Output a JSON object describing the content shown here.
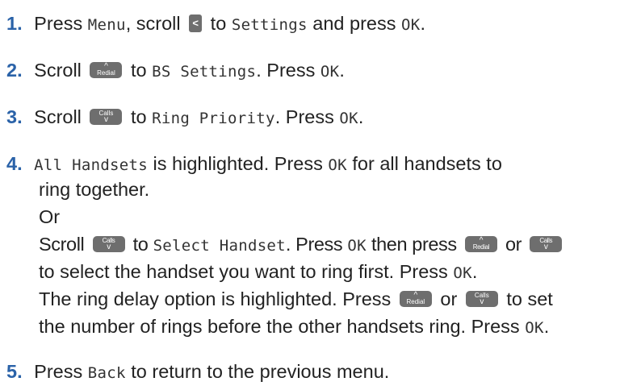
{
  "steps": {
    "s1": {
      "num": "1",
      "t1": "Press ",
      "menu": "Menu",
      "t2": ", scroll ",
      "t3": " to ",
      "settings": "Settings",
      "t4": " and press ",
      "ok": "OK",
      "t5": "."
    },
    "s2": {
      "num": "2",
      "t1": "Scroll ",
      "t2": " to ",
      "bs": "BS Settings",
      "t3": ". Press ",
      "ok": "OK",
      "t4": "."
    },
    "s3": {
      "num": "3",
      "t1": "Scroll ",
      "t2": " to ",
      "ring": "Ring Priority",
      "t3": ". Press ",
      "ok": "OK",
      "t4": "."
    },
    "s4": {
      "num": "4",
      "all": "All Handsets",
      "t1": " is highlighted. Press ",
      "ok": "OK",
      "t2": " for all handsets to",
      "l2": "ring together.",
      "or": "Or",
      "l4a": "Scroll ",
      "l4b": " to ",
      "select": "Select Handset",
      "l4c": ". Press ",
      "l4d": " then press ",
      "l4e": " or ",
      "l5a": "to select the handset you want to ring first. Press ",
      "l5b": ".",
      "l6a": "The ring delay option is highlighted. Press ",
      "l6b": " or ",
      "l6c": " to set",
      "l7a": "the number of rings before the other handsets ring. Press ",
      "l7b": "."
    },
    "s5": {
      "num": "5",
      "t1": "Press ",
      "back": "Back",
      "t2": " to return to the previous menu."
    }
  },
  "keys": {
    "redial_label": "Redial",
    "calls_label": "Calls",
    "up_glyph": "^",
    "down_glyph": "v",
    "left_glyph": "<"
  },
  "colors": {
    "step_number": "#2a62a8",
    "key_bg": "#6e6e6e",
    "text": "#222222"
  }
}
